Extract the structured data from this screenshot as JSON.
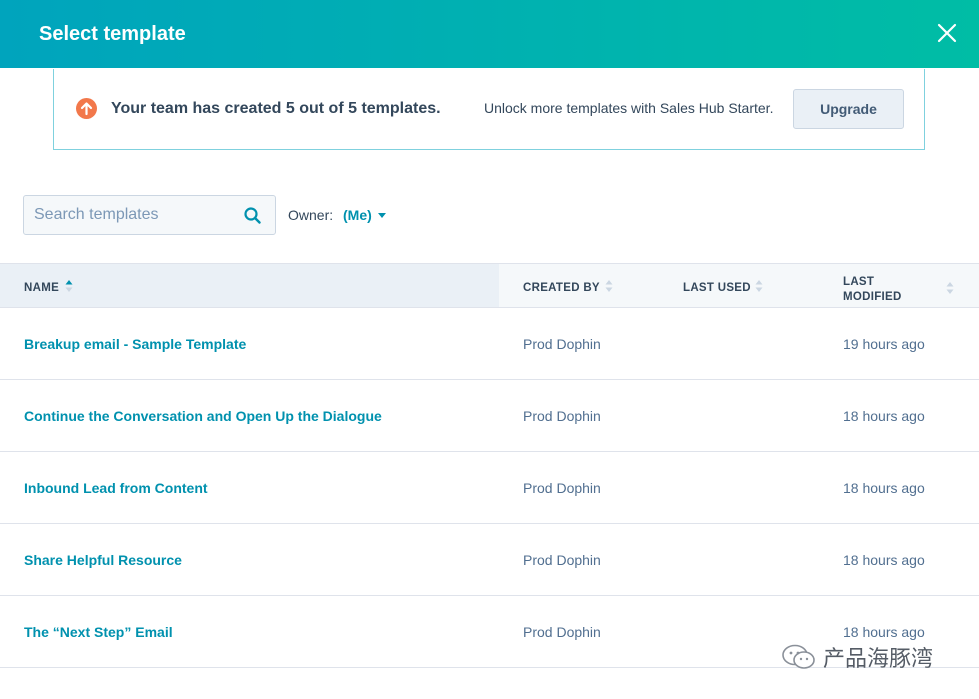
{
  "header": {
    "title": "Select template"
  },
  "banner": {
    "headline": "Your team has created 5 out of 5 templates.",
    "message": "Unlock more templates with Sales Hub Starter.",
    "upgrade_label": "Upgrade"
  },
  "search": {
    "placeholder": "Search templates",
    "value": ""
  },
  "owner": {
    "label": "Owner:",
    "value": "(Me)"
  },
  "table": {
    "columns": {
      "name": "NAME",
      "created_by": "CREATED BY",
      "last_used": "LAST USED",
      "last_modified_line1": "LAST",
      "last_modified_line2": "MODIFIED"
    },
    "rows": [
      {
        "name": "Breakup email - Sample Template",
        "created_by": "Prod Dophin",
        "last_used": "",
        "last_modified": "19 hours ago"
      },
      {
        "name": "Continue the Conversation and Open Up the Dialogue",
        "created_by": "Prod Dophin",
        "last_used": "",
        "last_modified": "18 hours ago"
      },
      {
        "name": "Inbound Lead from Content",
        "created_by": "Prod Dophin",
        "last_used": "",
        "last_modified": "18 hours ago"
      },
      {
        "name": "Share Helpful Resource",
        "created_by": "Prod Dophin",
        "last_used": "",
        "last_modified": "18 hours ago"
      },
      {
        "name": "The “Next Step” Email",
        "created_by": "Prod Dophin",
        "last_used": "",
        "last_modified": "18 hours ago"
      }
    ]
  },
  "watermark": {
    "text": "产品海豚湾"
  },
  "icons": {
    "close": "close-icon",
    "warning": "arrow-up-circle-icon",
    "search": "search-icon",
    "sort": "sort-icon",
    "caret": "caret-down-icon",
    "wechat": "wechat-icon"
  },
  "colors": {
    "header_start": "#00a4bd",
    "header_end": "#00bda5",
    "link": "#0091ae",
    "warning": "#f2784b",
    "text": "#33475b"
  }
}
